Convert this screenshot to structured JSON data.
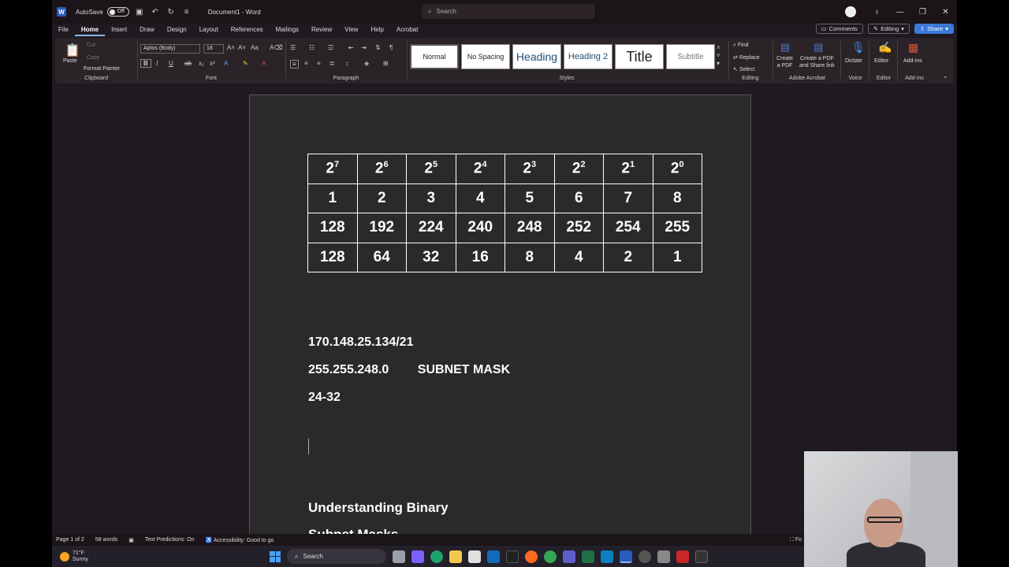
{
  "titlebar": {
    "autosave_label": "AutoSave",
    "autosave_state": "Off",
    "doc_title": "Document1 - Word",
    "search_placeholder": "Search"
  },
  "menubar": {
    "tabs": [
      "File",
      "Home",
      "Insert",
      "Draw",
      "Design",
      "Layout",
      "References",
      "Mailings",
      "Review",
      "View",
      "Help",
      "Acrobat"
    ],
    "active_tab": "Home",
    "comments": "Comments",
    "editing": "Editing",
    "share": "Share"
  },
  "ribbon": {
    "clipboard": {
      "paste": "Paste",
      "cut": "Cut",
      "copy": "Copy",
      "format_painter": "Format Painter",
      "label": "Clipboard"
    },
    "font": {
      "font_name": "Aptos (Body)",
      "font_size": "18",
      "label": "Font"
    },
    "paragraph": {
      "label": "Paragraph"
    },
    "styles": {
      "items": [
        "Normal",
        "No Spacing",
        "Heading",
        "Heading 2",
        "Title",
        "Subtitle"
      ],
      "label": "Styles"
    },
    "editing": {
      "find": "Find",
      "replace": "Replace",
      "select": "Select",
      "label": "Editing"
    },
    "acrobat": {
      "create_pdf_1": "Create",
      "create_pdf_2": "a PDF",
      "create_share_1": "Create a PDF",
      "create_share_2": "and Share link",
      "label": "Adobe Acrobat"
    },
    "voice": {
      "dictate": "Dictate",
      "label": "Voice"
    },
    "editor": {
      "editor": "Editor",
      "label": "Editor"
    },
    "addins": {
      "addins": "Add-ins",
      "label": "Add-ins"
    }
  },
  "document": {
    "table": {
      "header_base": "2",
      "header_exponents": [
        "7",
        "6",
        "5",
        "4",
        "3",
        "2",
        "1",
        "0"
      ],
      "rows": [
        [
          "1",
          "2",
          "3",
          "4",
          "5",
          "6",
          "7",
          "8"
        ],
        [
          "128",
          "192",
          "224",
          "240",
          "248",
          "252",
          "254",
          "255"
        ],
        [
          "128",
          "64",
          "32",
          "16",
          "8",
          "4",
          "2",
          "1"
        ]
      ]
    },
    "ip_line": "170.148.25.134/21",
    "mask_line": "255.255.248.0",
    "mask_label": "SUBNET MASK",
    "range_line": "24-32",
    "heading_1": "Understanding Binary",
    "heading_2": "Subnet Masks"
  },
  "statusbar": {
    "page": "Page 1 of 2",
    "words": "58 words",
    "text_predictions": "Text Predictions: On",
    "accessibility": "Accessibility: Good to go",
    "focus": "Fo"
  },
  "taskbar": {
    "temp": "71°F",
    "weather": "Sunny",
    "search": "Search"
  },
  "colors": {
    "accent": "#3c78d8",
    "page_bg": "#2a2a2a",
    "app_bg": "#1f1a1f"
  }
}
